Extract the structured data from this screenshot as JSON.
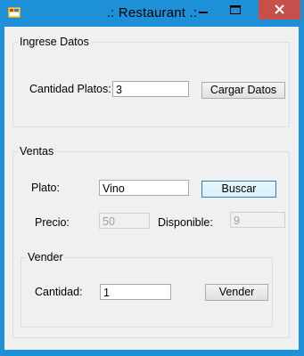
{
  "window": {
    "title": ".: Restaurant .:",
    "accent": "#1e90d8",
    "close_color": "#c7504b"
  },
  "ingrese": {
    "legend": "Ingrese Datos",
    "cantidad_label": "Cantidad Platos:",
    "cantidad_value": "3",
    "cargar_button": "Cargar Datos"
  },
  "ventas": {
    "legend": "Ventas",
    "plato_label": "Plato:",
    "plato_value": "Vino",
    "buscar_button": "Buscar",
    "precio_label": "Precio:",
    "precio_value": "50",
    "disponible_label": "Disponible:",
    "disponible_value": "9"
  },
  "vender": {
    "legend": "Vender",
    "cantidad_label": "Cantidad:",
    "cantidad_value": "1",
    "vender_button": "Vender"
  }
}
